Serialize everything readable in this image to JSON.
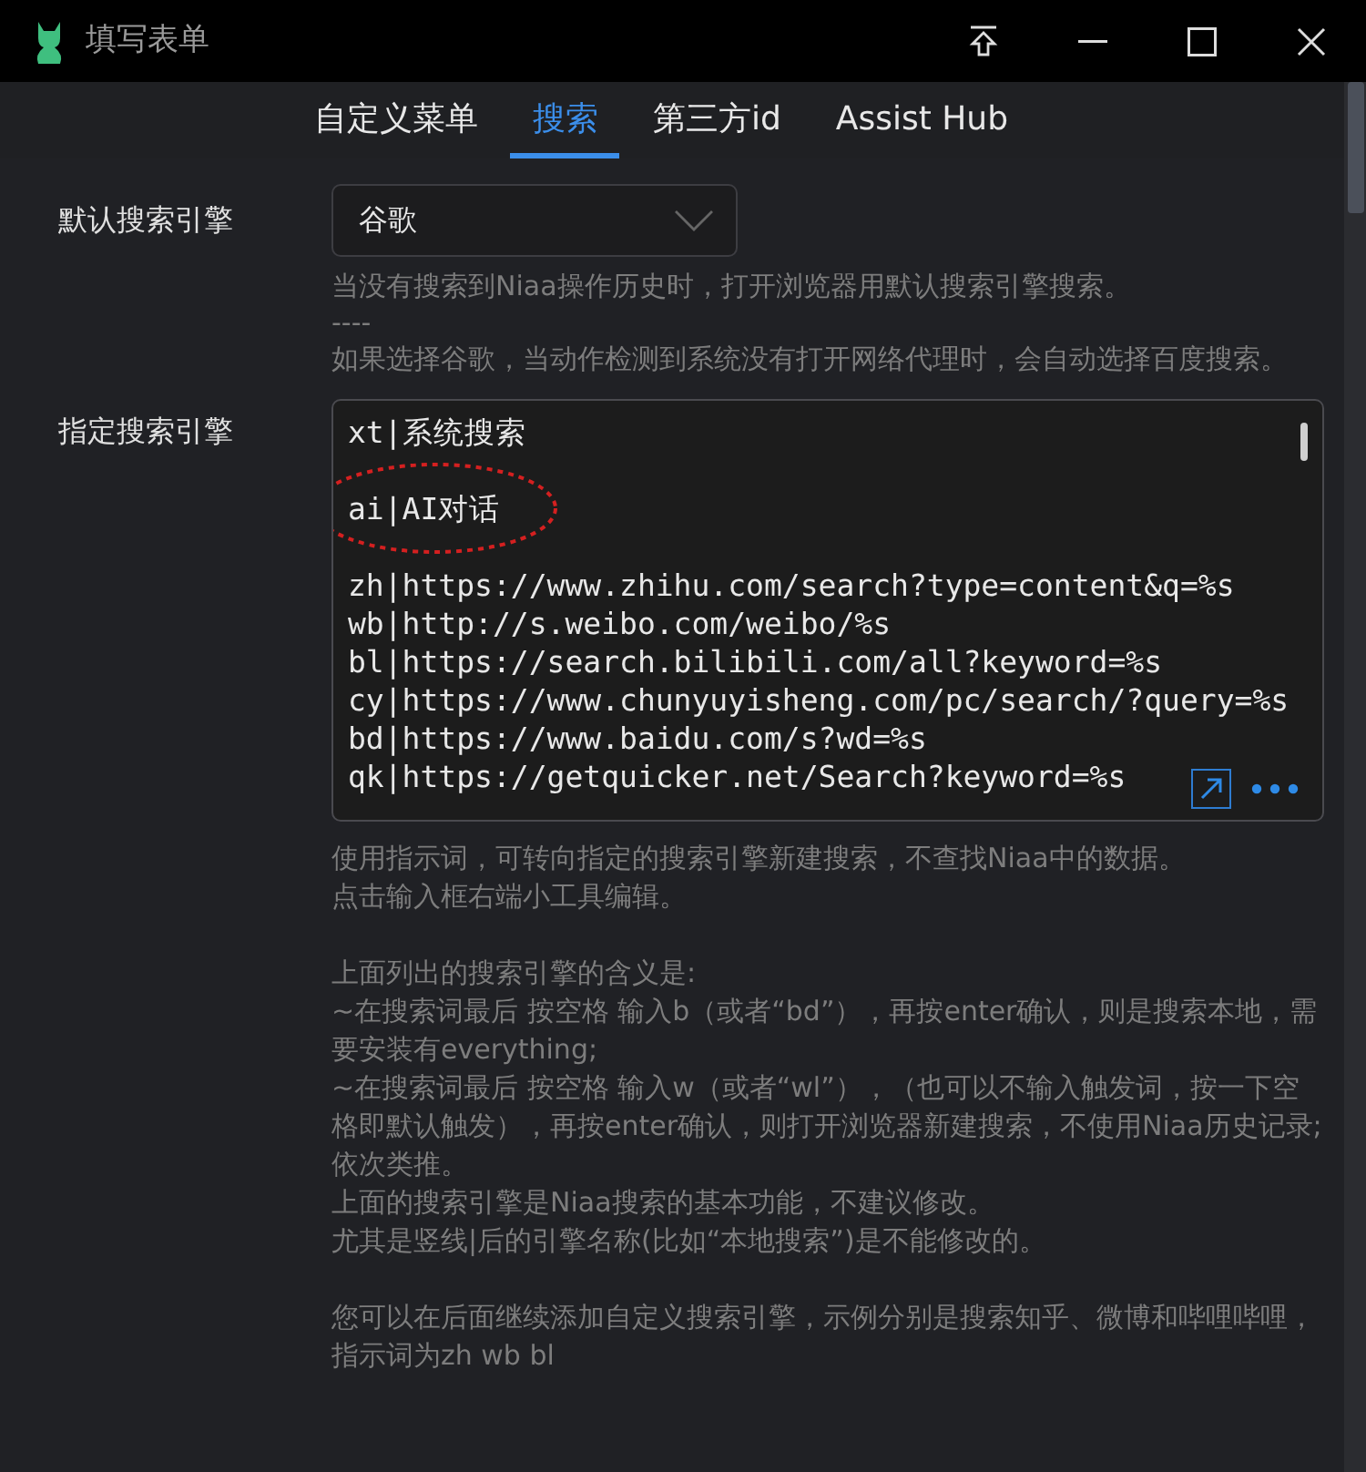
{
  "window": {
    "title": "填写表单"
  },
  "tabs": [
    {
      "label": "自定义菜单",
      "selected": false
    },
    {
      "label": "搜索",
      "selected": true
    },
    {
      "label": "第三方id",
      "selected": false
    },
    {
      "label": "Assist Hub",
      "selected": false
    }
  ],
  "default_engine": {
    "label": "默认搜索引擎",
    "value": "谷歌",
    "help": [
      "当没有搜索到Niaa操作历史时，打开浏览器用默认搜索引擎搜索。",
      "----",
      "如果选择谷歌，当动作检测到系统没有打开网络代理时，会自动选择百度搜索。"
    ]
  },
  "engines": {
    "label": "指定搜索引擎",
    "groups": [
      {
        "circled": false,
        "lines": [
          "xt|系统搜索"
        ]
      },
      {
        "circled": true,
        "lines": [
          "ai|AI对话"
        ]
      },
      {
        "circled": false,
        "lines": [
          "zh|https://www.zhihu.com/search?type=content&q=%s",
          "wb|http://s.weibo.com/weibo/%s",
          "bl|https://search.bilibili.com/all?keyword=%s",
          "cy|https://www.chunyuyisheng.com/pc/search/?query=%s",
          "bd|https://www.baidu.com/s?wd=%s",
          "qk|https://getquicker.net/Search?keyword=%s"
        ]
      }
    ],
    "help": [
      [
        "使用指示词，可转向指定的搜索引擎新建搜索，不查找Niaa中的数据。",
        "点击输入框右端小工具编辑。"
      ],
      [
        "上面列出的搜索引擎的含义是:",
        "~在搜索词最后 按空格 输入b（或者“bd”），再按enter确认，则是搜索本地，需要安装有everything;",
        "~在搜索词最后 按空格 输入w（或者“wl”），（也可以不输入触发词，按一下空格即默认触发），再按enter确认，则打开浏览器新建搜索，不使用Niaa历史记录;",
        "依次类推。",
        "上面的搜索引擎是Niaa搜索的基本功能，不建议修改。",
        "尤其是竖线|后的引擎名称(比如“本地搜索”)是不能修改的。"
      ],
      [
        "您可以在后面继续添加自定义搜索引擎，示例分别是搜索知乎、微博和哔哩哔哩，指示词为zh wb bl"
      ]
    ]
  }
}
